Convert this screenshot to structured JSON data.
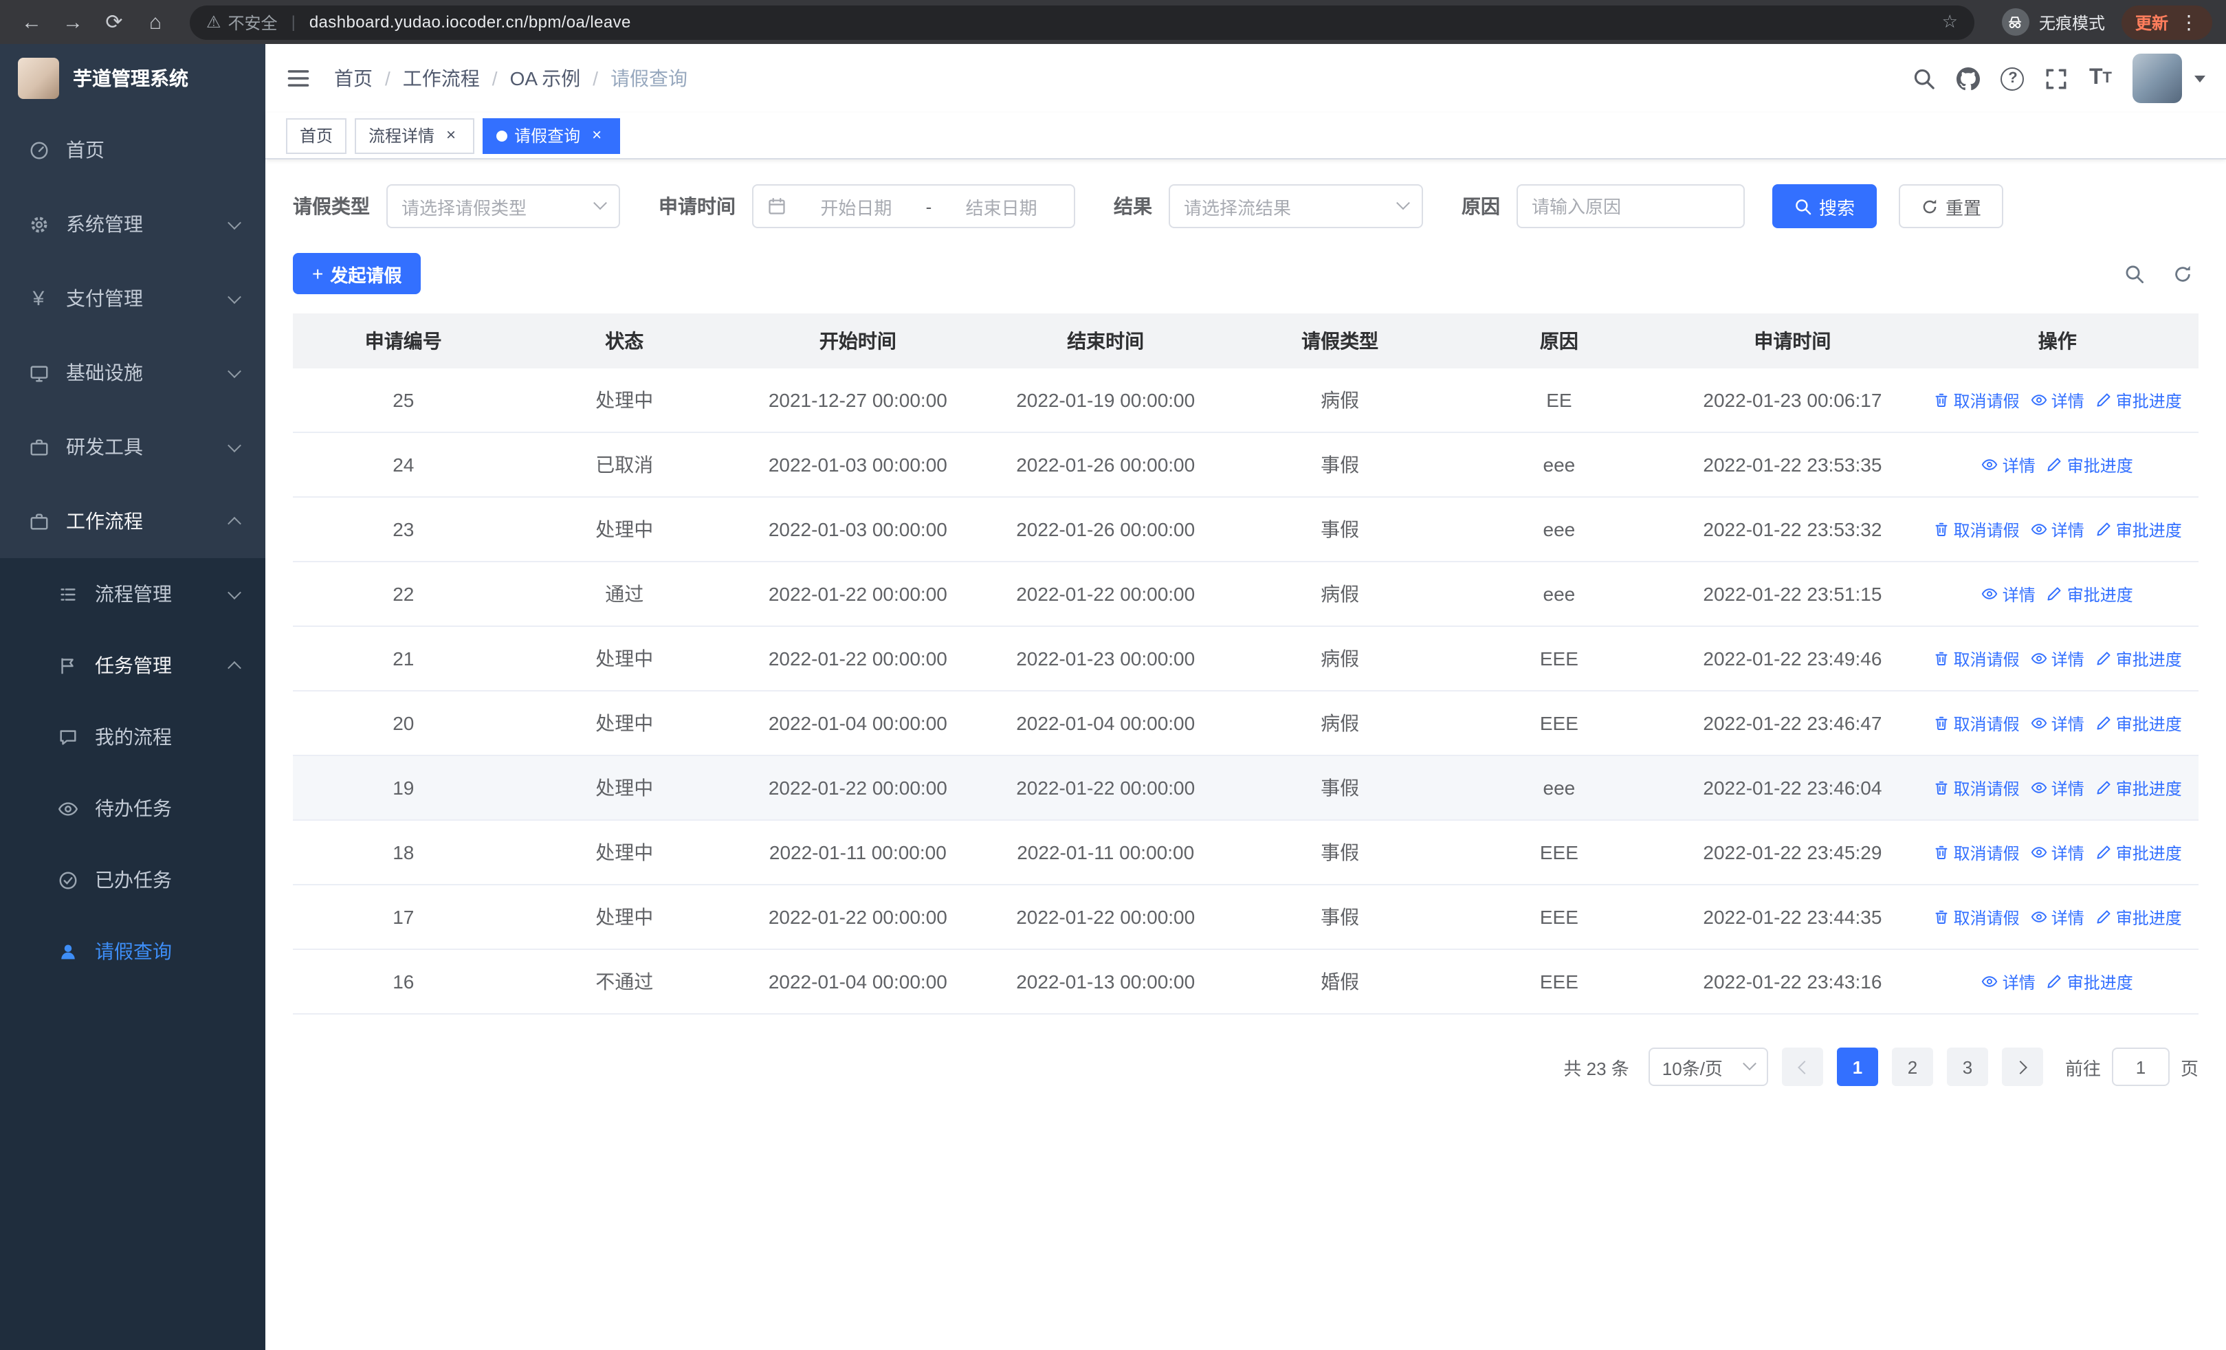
{
  "browser": {
    "warning_label": "不安全",
    "url": "dashboard.yudao.iocoder.cn/bpm/oa/leave",
    "incognito_label": "无痕模式",
    "update_label": "更新"
  },
  "icons": {
    "back": "←",
    "forward": "→",
    "reload": "⟳",
    "home": "⌂",
    "warning": "⚠",
    "star": "☆",
    "menu_dots": "⋮",
    "yen": "¥",
    "plus": "+"
  },
  "sidebar": {
    "title": "芋道管理系统",
    "items": [
      {
        "label": "首页"
      },
      {
        "label": "系统管理"
      },
      {
        "label": "支付管理"
      },
      {
        "label": "基础设施"
      },
      {
        "label": "研发工具"
      },
      {
        "label": "工作流程"
      }
    ],
    "submenu": [
      {
        "label": "流程管理"
      },
      {
        "label": "任务管理"
      }
    ],
    "tasks": [
      {
        "label": "我的流程"
      },
      {
        "label": "待办任务"
      },
      {
        "label": "已办任务"
      },
      {
        "label": "请假查询"
      }
    ]
  },
  "header": {
    "breadcrumb": [
      "首页",
      "工作流程",
      "OA 示例",
      "请假查询"
    ]
  },
  "tabs": [
    {
      "label": "首页"
    },
    {
      "label": "流程详情"
    },
    {
      "label": "请假查询"
    }
  ],
  "filters": {
    "leave_type_label": "请假类型",
    "leave_type_placeholder": "请选择请假类型",
    "apply_time_label": "申请时间",
    "start_date_placeholder": "开始日期",
    "range_separator": "-",
    "end_date_placeholder": "结束日期",
    "result_label": "结果",
    "result_placeholder": "请选择流结果",
    "reason_label": "原因",
    "reason_placeholder": "请输入原因",
    "search_label": "搜索",
    "reset_label": "重置"
  },
  "actions": {
    "create_label": "发起请假"
  },
  "table": {
    "columns": [
      "申请编号",
      "状态",
      "开始时间",
      "结束时间",
      "请假类型",
      "原因",
      "申请时间",
      "操作"
    ],
    "rows": [
      {
        "id": "25",
        "status": "处理中",
        "start": "2021-12-27 00:00:00",
        "end": "2022-01-19 00:00:00",
        "type": "病假",
        "reason": "EE",
        "applied": "2022-01-23 00:06:17",
        "ops": [
          {
            "label": "取消请假",
            "name": "cancel-leave-link",
            "icon": "delete-icon"
          },
          {
            "label": "详情",
            "name": "detail-link",
            "icon": "view-icon"
          },
          {
            "label": "审批进度",
            "name": "approval-progress-link",
            "icon": "progress-icon"
          }
        ]
      },
      {
        "id": "24",
        "status": "已取消",
        "start": "2022-01-03 00:00:00",
        "end": "2022-01-26 00:00:00",
        "type": "事假",
        "reason": "eee",
        "applied": "2022-01-22 23:53:35",
        "ops": [
          {
            "label": "详情",
            "name": "detail-link",
            "icon": "view-icon"
          },
          {
            "label": "审批进度",
            "name": "approval-progress-link",
            "icon": "progress-icon"
          }
        ]
      },
      {
        "id": "23",
        "status": "处理中",
        "start": "2022-01-03 00:00:00",
        "end": "2022-01-26 00:00:00",
        "type": "事假",
        "reason": "eee",
        "applied": "2022-01-22 23:53:32",
        "ops": [
          {
            "label": "取消请假",
            "name": "cancel-leave-link",
            "icon": "delete-icon"
          },
          {
            "label": "详情",
            "name": "detail-link",
            "icon": "view-icon"
          },
          {
            "label": "审批进度",
            "name": "approval-progress-link",
            "icon": "progress-icon"
          }
        ]
      },
      {
        "id": "22",
        "status": "通过",
        "start": "2022-01-22 00:00:00",
        "end": "2022-01-22 00:00:00",
        "type": "病假",
        "reason": "eee",
        "applied": "2022-01-22 23:51:15",
        "ops": [
          {
            "label": "详情",
            "name": "detail-link",
            "icon": "view-icon"
          },
          {
            "label": "审批进度",
            "name": "approval-progress-link",
            "icon": "progress-icon"
          }
        ]
      },
      {
        "id": "21",
        "status": "处理中",
        "start": "2022-01-22 00:00:00",
        "end": "2022-01-23 00:00:00",
        "type": "病假",
        "reason": "EEE",
        "applied": "2022-01-22 23:49:46",
        "ops": [
          {
            "label": "取消请假",
            "name": "cancel-leave-link",
            "icon": "delete-icon"
          },
          {
            "label": "详情",
            "name": "detail-link",
            "icon": "view-icon"
          },
          {
            "label": "审批进度",
            "name": "approval-progress-link",
            "icon": "progress-icon"
          }
        ]
      },
      {
        "id": "20",
        "status": "处理中",
        "start": "2022-01-04 00:00:00",
        "end": "2022-01-04 00:00:00",
        "type": "病假",
        "reason": "EEE",
        "applied": "2022-01-22 23:46:47",
        "ops": [
          {
            "label": "取消请假",
            "name": "cancel-leave-link",
            "icon": "delete-icon"
          },
          {
            "label": "详情",
            "name": "detail-link",
            "icon": "view-icon"
          },
          {
            "label": "审批进度",
            "name": "approval-progress-link",
            "icon": "progress-icon"
          }
        ]
      },
      {
        "id": "19",
        "status": "处理中",
        "start": "2022-01-22 00:00:00",
        "end": "2022-01-22 00:00:00",
        "type": "事假",
        "reason": "eee",
        "applied": "2022-01-22 23:46:04",
        "hover": true,
        "ops": [
          {
            "label": "取消请假",
            "name": "cancel-leave-link",
            "icon": "delete-icon"
          },
          {
            "label": "详情",
            "name": "detail-link",
            "icon": "view-icon"
          },
          {
            "label": "审批进度",
            "name": "approval-progress-link",
            "icon": "progress-icon"
          }
        ]
      },
      {
        "id": "18",
        "status": "处理中",
        "start": "2022-01-11 00:00:00",
        "end": "2022-01-11 00:00:00",
        "type": "事假",
        "reason": "EEE",
        "applied": "2022-01-22 23:45:29",
        "ops": [
          {
            "label": "取消请假",
            "name": "cancel-leave-link",
            "icon": "delete-icon"
          },
          {
            "label": "详情",
            "name": "detail-link",
            "icon": "view-icon"
          },
          {
            "label": "审批进度",
            "name": "approval-progress-link",
            "icon": "progress-icon"
          }
        ]
      },
      {
        "id": "17",
        "status": "处理中",
        "start": "2022-01-22 00:00:00",
        "end": "2022-01-22 00:00:00",
        "type": "事假",
        "reason": "EEE",
        "applied": "2022-01-22 23:44:35",
        "ops": [
          {
            "label": "取消请假",
            "name": "cancel-leave-link",
            "icon": "delete-icon"
          },
          {
            "label": "详情",
            "name": "detail-link",
            "icon": "view-icon"
          },
          {
            "label": "审批进度",
            "name": "approval-progress-link",
            "icon": "progress-icon"
          }
        ]
      },
      {
        "id": "16",
        "status": "不通过",
        "start": "2022-01-04 00:00:00",
        "end": "2022-01-13 00:00:00",
        "type": "婚假",
        "reason": "EEE",
        "applied": "2022-01-22 23:43:16",
        "ops": [
          {
            "label": "详情",
            "name": "detail-link",
            "icon": "view-icon"
          },
          {
            "label": "审批进度",
            "name": "approval-progress-link",
            "icon": "progress-icon"
          }
        ]
      }
    ]
  },
  "pagination": {
    "total": "共 23 条",
    "page_size": "10条/页",
    "pages": [
      "1",
      "2",
      "3"
    ],
    "current": "1",
    "goto_label": "前往",
    "goto_value": "1",
    "page_unit": "页"
  }
}
